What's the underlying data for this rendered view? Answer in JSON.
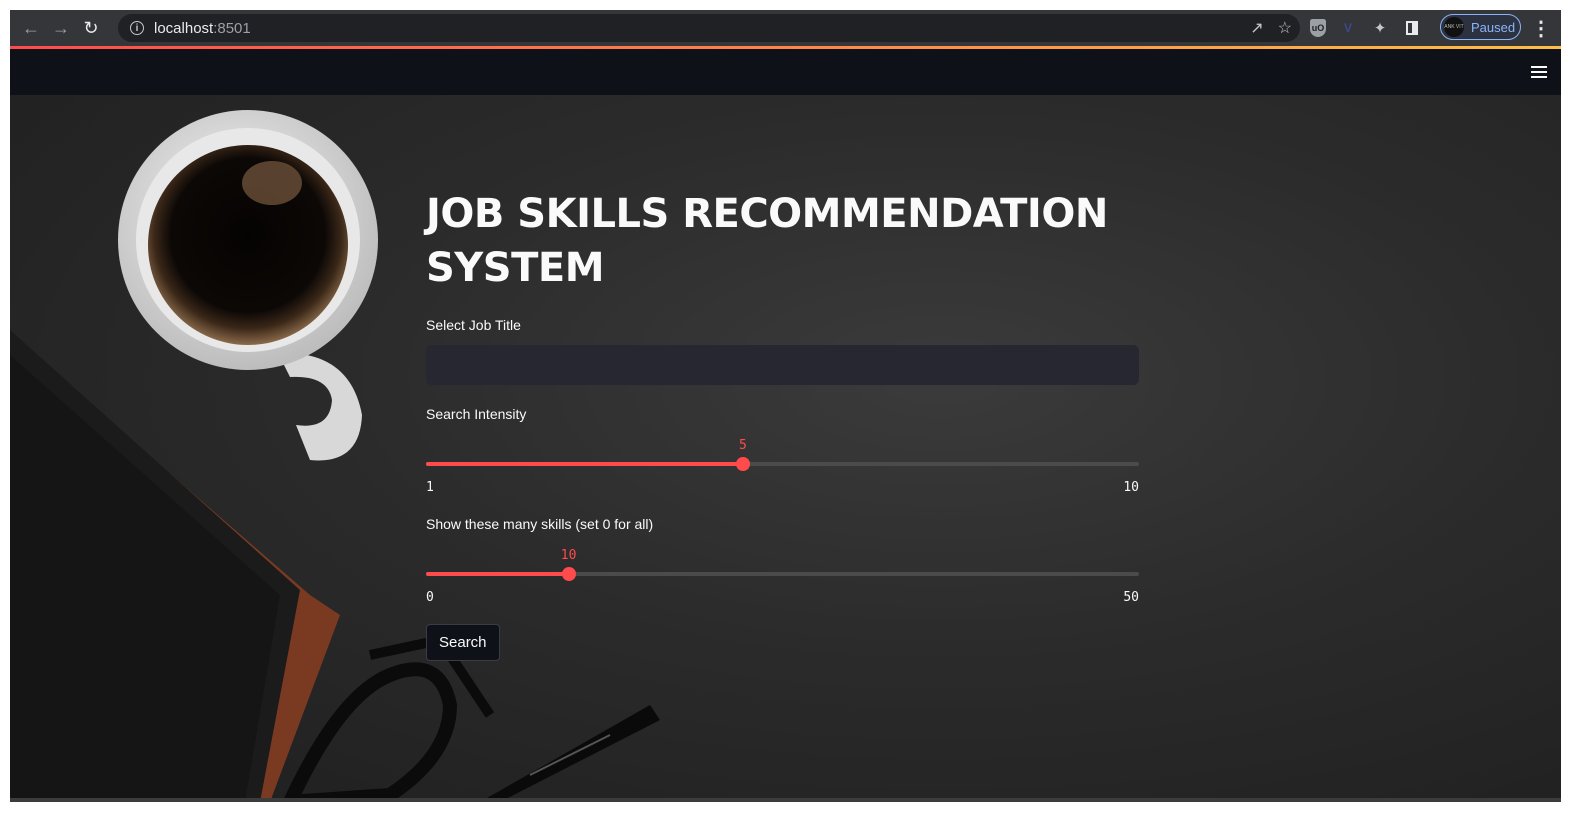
{
  "browser": {
    "host": "localhost",
    "port": ":8501",
    "profile_label": "Paused",
    "profile_avatar_text": "ANK VIT",
    "icons": [
      "back-arrow-icon",
      "forward-arrow-icon",
      "reload-icon",
      "info-icon",
      "share-icon",
      "star-icon",
      "ublock-icon",
      "vue-devtools-icon",
      "extensions-icon",
      "side-panel-icon",
      "menu-kebab-icon"
    ]
  },
  "app": {
    "title": "JOB SKILLS RECOMMENDATION SYSTEM",
    "accent_color": "#ff4b4b",
    "job_title": {
      "label": "Select Job Title",
      "value": ""
    },
    "intensity": {
      "label": "Search Intensity",
      "min": 1,
      "max": 10,
      "value": 5,
      "min_label": "1",
      "max_label": "10",
      "value_label": "5"
    },
    "skills_count": {
      "label": "Show these many skills (set 0 for all)",
      "min": 0,
      "max": 50,
      "value": 10,
      "min_label": "0",
      "max_label": "50",
      "value_label": "10"
    },
    "search_button": "Search"
  }
}
